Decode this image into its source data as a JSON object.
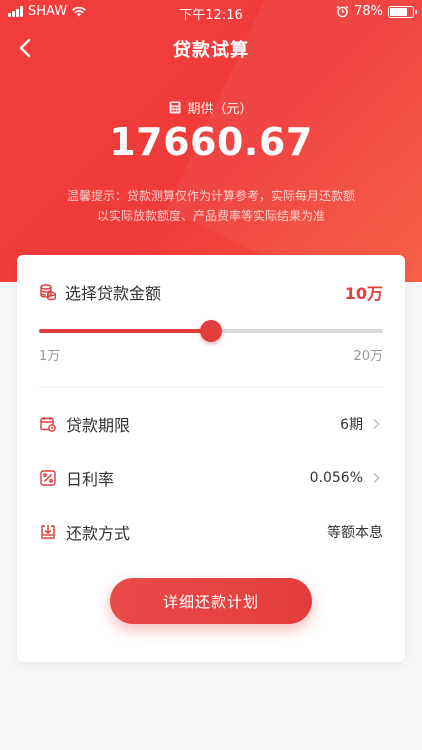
{
  "status_bar": {
    "carrier": "SHAW",
    "time": "下午12:16",
    "battery": "78%",
    "battery_level": 0.78
  },
  "header": {
    "title": "贷款试算",
    "back_icon": "chevron-left-icon"
  },
  "summary": {
    "label": "期供（元）",
    "amount": "17660.67",
    "tip_line1": "温馨提示：贷款测算仅作为计算参考，实际每月还款额",
    "tip_line2": "以实际放款额度、产品费率等实际结果为准"
  },
  "amount_selector": {
    "label": "选择贷款金额",
    "value": "10万",
    "min_label": "1万",
    "max_label": "20万",
    "slider_fraction": 0.5
  },
  "options": [
    {
      "label": "贷款期限",
      "value": "6期",
      "icon": "calendar-icon",
      "has_chevron": true
    },
    {
      "label": "日利率",
      "value": "0.056%",
      "icon": "percent-icon",
      "has_chevron": true
    },
    {
      "label": "还款方式",
      "value": "等额本息",
      "icon": "repayment-icon",
      "has_chevron": false
    }
  ],
  "cta": {
    "label": "详细还款计划"
  },
  "colors": {
    "brand_red": "#e23d3d",
    "hero_red": "#f23c3c"
  }
}
